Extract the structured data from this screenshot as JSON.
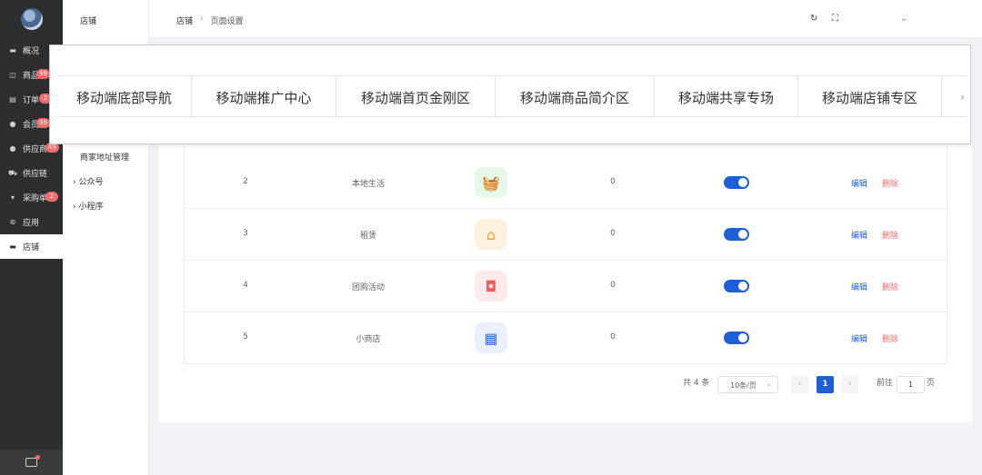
{
  "sidebar": {
    "items": [
      {
        "label": "概况",
        "icon": "monitor-icon",
        "badge": ""
      },
      {
        "label": "商品",
        "icon": "bag-icon",
        "badge": "99"
      },
      {
        "label": "订单",
        "icon": "order-icon",
        "badge": "2"
      },
      {
        "label": "会员",
        "icon": "user-icon",
        "badge": "99"
      },
      {
        "label": "供应商",
        "icon": "supplier-icon",
        "badge": "49"
      },
      {
        "label": "供应链",
        "icon": "truck-icon",
        "badge": ""
      },
      {
        "label": "采购单",
        "icon": "cart-icon",
        "badge": "2"
      },
      {
        "label": "应用",
        "icon": "apps-icon",
        "badge": ""
      },
      {
        "label": "店铺",
        "icon": "store-icon",
        "badge": ""
      }
    ]
  },
  "subnav": {
    "title": "店铺",
    "items": [
      "商家地址管理",
      "公众号",
      "小程序"
    ]
  },
  "header": {
    "crumbs": [
      "店铺",
      "页面设置"
    ],
    "refresh_icon": "refresh-icon",
    "fullscreen_icon": "fullscreen-icon"
  },
  "table": {
    "rows": [
      {
        "index": "2",
        "name": "本地生活",
        "icon": "basket-icon",
        "icon_bg": "#e5f8e9",
        "icon_fg": "#2fbf5a",
        "sort": "0"
      },
      {
        "index": "3",
        "name": "租赁",
        "icon": "house-icon",
        "icon_bg": "#fff1e0",
        "icon_fg": "#f5a030",
        "sort": "0"
      },
      {
        "index": "4",
        "name": "团购活动",
        "icon": "shopping-bag-icon",
        "icon_bg": "#fdebeb",
        "icon_fg": "#ef5a5a",
        "sort": "0"
      },
      {
        "index": "5",
        "name": "小商店",
        "icon": "shop-icon",
        "icon_bg": "#eaf0fd",
        "icon_fg": "#3a6fe0",
        "sort": "0"
      }
    ],
    "edit_label": "编辑",
    "delete_label": "删除"
  },
  "pagination": {
    "total": "共 4 条",
    "page_size": "10条/页",
    "current_page": "1",
    "goto_label": "前往",
    "goto_value": "1",
    "page_unit": "页"
  },
  "overlay": {
    "tabs": [
      "移动端底部导航",
      "移动端推广中心",
      "移动端首页金刚区",
      "移动端商品简介区",
      "移动端共享专场",
      "移动端店铺专区"
    ]
  },
  "colors": {
    "accent": "#1f5fd6",
    "danger": "#f56c6c",
    "sidebar_bg": "#2d2e2f"
  }
}
